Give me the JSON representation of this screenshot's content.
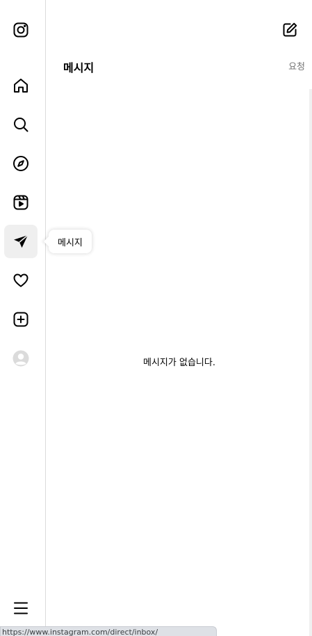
{
  "sidebar": {
    "items": [
      {
        "name": "instagram-logo",
        "icon": "instagram-icon"
      },
      {
        "name": "home",
        "icon": "home-icon"
      },
      {
        "name": "search",
        "icon": "search-icon"
      },
      {
        "name": "explore",
        "icon": "compass-icon"
      },
      {
        "name": "reels",
        "icon": "reels-icon"
      },
      {
        "name": "messages",
        "icon": "send-icon",
        "active": true
      },
      {
        "name": "notifications",
        "icon": "heart-icon"
      },
      {
        "name": "create",
        "icon": "plus-square-icon"
      },
      {
        "name": "profile",
        "icon": "avatar-icon"
      },
      {
        "name": "more",
        "icon": "menu-icon"
      }
    ],
    "tooltip": "메시지"
  },
  "panel": {
    "title": "메시지",
    "requests_label": "요청",
    "empty_text": "메시지가 없습니다.",
    "compose_icon": "compose-icon"
  },
  "status_bar": {
    "url": "https://www.instagram.com/direct/inbox/"
  },
  "colors": {
    "active_bg": "#efefef",
    "divider": "#dbdbdb",
    "muted_text": "#737373"
  }
}
